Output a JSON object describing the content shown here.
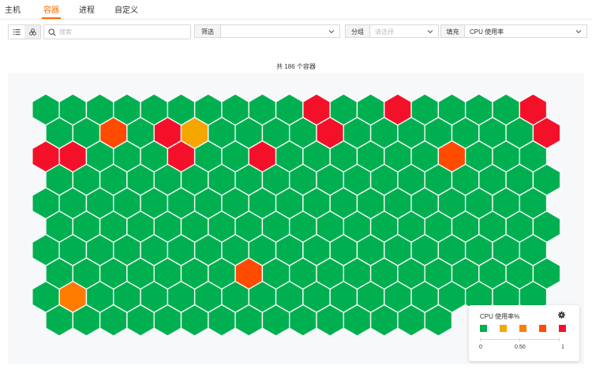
{
  "tabs": [
    {
      "label": "主机",
      "active": false
    },
    {
      "label": "容器",
      "active": true
    },
    {
      "label": "进程",
      "active": false
    },
    {
      "label": "自定义",
      "active": false
    }
  ],
  "toolbar": {
    "search_placeholder": "搜索",
    "filter_label": "筛选",
    "filter_value": "",
    "group_label": "分组",
    "group_placeholder": "请选择",
    "fill_label": "填充",
    "fill_value": "CPU 使用率"
  },
  "summary": {
    "count_text": "共 186 个容器"
  },
  "hexmap": {
    "rows": 10,
    "row_counts": [
      19,
      19,
      19,
      19,
      19,
      19,
      19,
      19,
      19,
      15
    ],
    "hot": [
      {
        "row": 0,
        "col": 10,
        "color": "red"
      },
      {
        "row": 0,
        "col": 13,
        "color": "red"
      },
      {
        "row": 0,
        "col": 18,
        "color": "red"
      },
      {
        "row": 1,
        "col": 2,
        "color": "orange_red"
      },
      {
        "row": 1,
        "col": 4,
        "color": "red"
      },
      {
        "row": 1,
        "col": 5,
        "color": "yellow"
      },
      {
        "row": 1,
        "col": 10,
        "color": "red"
      },
      {
        "row": 1,
        "col": 18,
        "color": "red"
      },
      {
        "row": 2,
        "col": 0,
        "color": "red"
      },
      {
        "row": 2,
        "col": 1,
        "color": "red"
      },
      {
        "row": 2,
        "col": 5,
        "color": "red"
      },
      {
        "row": 2,
        "col": 8,
        "color": "red"
      },
      {
        "row": 2,
        "col": 15,
        "color": "orange_red"
      },
      {
        "row": 7,
        "col": 7,
        "color": "orange_red"
      },
      {
        "row": 8,
        "col": 1,
        "color": "orange"
      }
    ]
  },
  "legend": {
    "title": "CPU 使用率%",
    "colors": [
      "#00b050",
      "#f5a700",
      "#ff7c00",
      "#ff4b00",
      "#f5102a"
    ],
    "ticks": [
      "0",
      "0.50",
      "1"
    ]
  },
  "colors": {
    "accent": "#ff6a00",
    "green": "#00b050",
    "yellow": "#f5a700",
    "orange": "#ff7c00",
    "orange_red": "#ff4b00",
    "red": "#f5102a"
  }
}
